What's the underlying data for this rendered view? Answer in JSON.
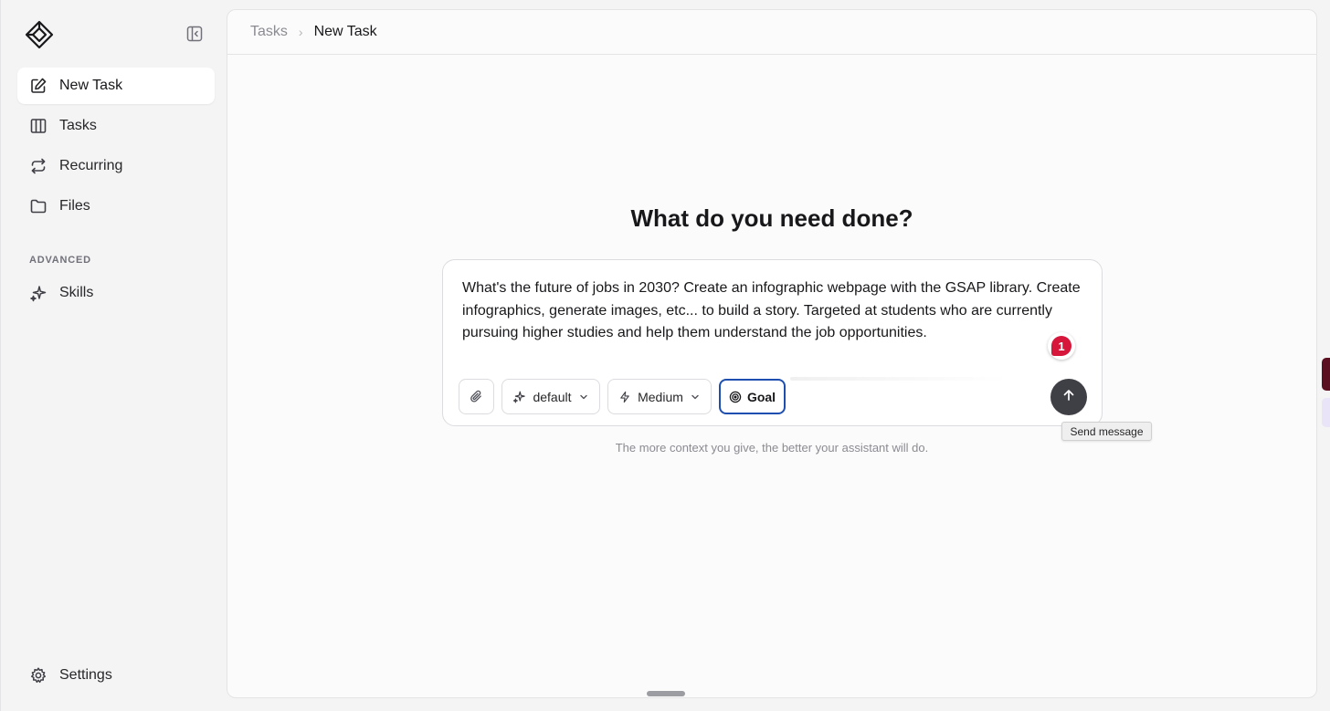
{
  "sidebar": {
    "nav": [
      {
        "label": "New Task",
        "icon": "pencil-square-icon",
        "active": true
      },
      {
        "label": "Tasks",
        "icon": "columns-icon",
        "active": false
      },
      {
        "label": "Recurring",
        "icon": "repeat-icon",
        "active": false
      },
      {
        "label": "Files",
        "icon": "folder-icon",
        "active": false
      }
    ],
    "section_label": "ADVANCED",
    "advanced": [
      {
        "label": "Skills",
        "icon": "sparkles-icon"
      }
    ],
    "settings_label": "Settings"
  },
  "breadcrumb": {
    "parent": "Tasks",
    "current": "New Task"
  },
  "main": {
    "heading": "What do you need done?",
    "prompt_text": "What's the future of jobs in 2030? Create an infographic webpage with the GSAP library. Create infographics, generate images, etc... to build a story. Targeted at students who are currently pursuing higher studies and help them understand the job opportunities.",
    "model_label": "default",
    "effort_label": "Medium",
    "goal_label": "Goal",
    "badge_count": "1",
    "send_tooltip": "Send message",
    "hint": "The more context you give, the better your assistant will do."
  },
  "colors": {
    "goal_border": "#1e4fb0",
    "badge": "#d6163a",
    "send_button": "#3f3f46"
  }
}
